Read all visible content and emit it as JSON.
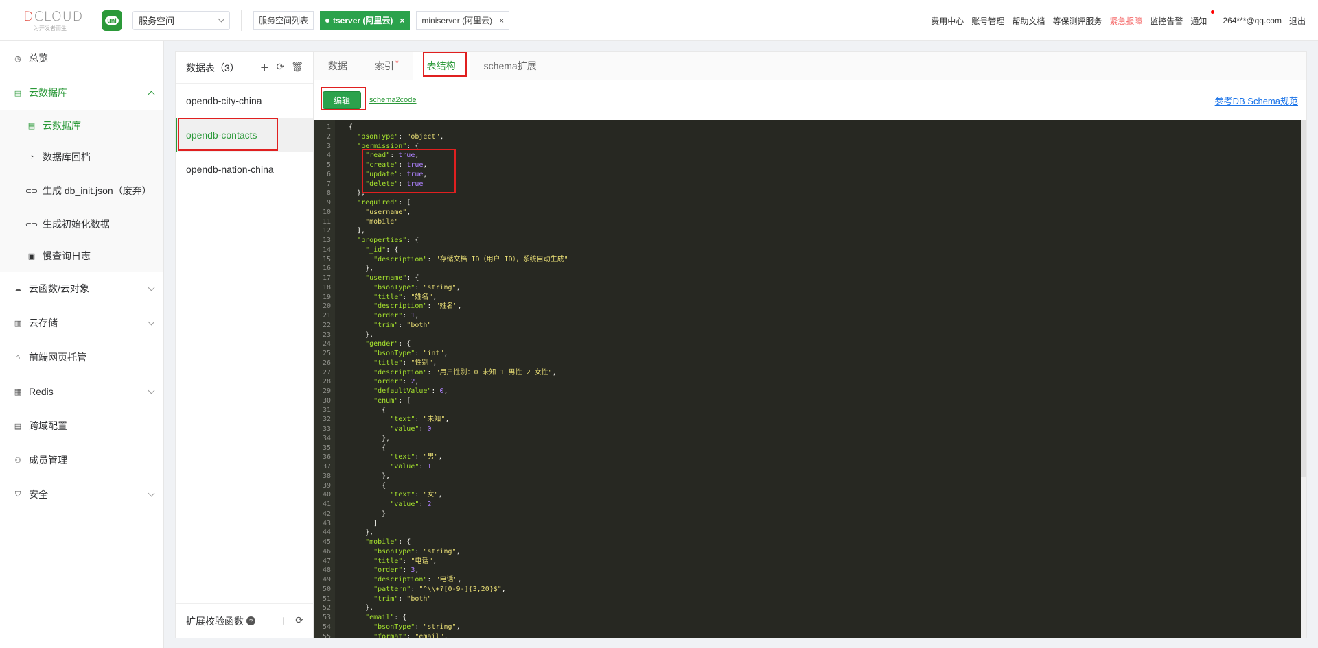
{
  "header": {
    "logo_text_a": "D",
    "logo_text_b": "CLOUD",
    "logo_sub": "为开发者而生",
    "uni_label": "uni",
    "space_select": "服务空间",
    "tabs": [
      {
        "label": "服务空间列表"
      },
      {
        "label": "tserver (阿里云)"
      },
      {
        "label": "miniserver (阿里云)"
      }
    ],
    "close_glyph": "×",
    "links": [
      "费用中心",
      "账号管理",
      "帮助文档",
      "等保测评服务",
      "紧急报障",
      "监控告警"
    ],
    "notice": "通知",
    "user": "264***@qq.com",
    "logout": "退出"
  },
  "sidebar": {
    "items": [
      {
        "label": "总览",
        "icon": "clock-icon"
      },
      {
        "label": "云数据库",
        "icon": "database-icon"
      },
      {
        "label": "云函数/云对象",
        "icon": "cloud-icon"
      },
      {
        "label": "云存储",
        "icon": "storage-icon"
      },
      {
        "label": "前端网页托管",
        "icon": "host-icon"
      },
      {
        "label": "Redis",
        "icon": "redis-icon"
      },
      {
        "label": "跨域配置",
        "icon": "cors-icon"
      },
      {
        "label": "成员管理",
        "icon": "user-icon"
      },
      {
        "label": "安全",
        "icon": "shield-icon"
      }
    ],
    "db_sub": [
      {
        "label": "云数据库"
      },
      {
        "label": "数据库回档"
      },
      {
        "label": "生成 db_init.json（废弃）"
      },
      {
        "label": "生成初始化数据"
      },
      {
        "label": "慢查询日志"
      }
    ]
  },
  "tables": {
    "header": "数据表（3）",
    "items": [
      "opendb-city-china",
      "opendb-contacts",
      "opendb-nation-china"
    ],
    "footer": "扩展校验函数",
    "help": "?"
  },
  "main": {
    "tabs": [
      "数据",
      "索引",
      "表结构",
      "schema扩展"
    ],
    "index_star": "*",
    "edit_button": "编辑",
    "schema2code": "schema2code",
    "ref_link": "参考DB Schema规范"
  },
  "code_lines": [
    "{",
    "  \"bsonType\": \"object\",",
    "  \"permission\": {",
    "    \"read\": true,",
    "    \"create\": true,",
    "    \"update\": true,",
    "    \"delete\": true",
    "  },",
    "  \"required\": [",
    "    \"username\",",
    "    \"mobile\"",
    "  ],",
    "  \"properties\": {",
    "    \"_id\": {",
    "      \"description\": \"存储文档 ID（用户 ID），系统自动生成\"",
    "    },",
    "    \"username\": {",
    "      \"bsonType\": \"string\",",
    "      \"title\": \"姓名\",",
    "      \"description\": \"姓名\",",
    "      \"order\": 1,",
    "      \"trim\": \"both\"",
    "    },",
    "    \"gender\": {",
    "      \"bsonType\": \"int\",",
    "      \"title\": \"性别\",",
    "      \"description\": \"用户性别：0 未知 1 男性 2 女性\",",
    "      \"order\": 2,",
    "      \"defaultValue\": 0,",
    "      \"enum\": [",
    "        {",
    "          \"text\": \"未知\",",
    "          \"value\": 0",
    "        },",
    "        {",
    "          \"text\": \"男\",",
    "          \"value\": 1",
    "        },",
    "        {",
    "          \"text\": \"女\",",
    "          \"value\": 2",
    "        }",
    "      ]",
    "    },",
    "    \"mobile\": {",
    "      \"bsonType\": \"string\",",
    "      \"title\": \"电话\",",
    "      \"order\": 3,",
    "      \"description\": \"电话\",",
    "      \"pattern\": \"^\\\\+?[0-9-]{3,20}$\",",
    "      \"trim\": \"both\"",
    "    },",
    "    \"email\": {",
    "      \"bsonType\": \"string\",",
    "      \"format\": \"email\","
  ],
  "colors": {
    "brand_green": "#2ba24c",
    "editor_bg": "#272822",
    "highlight_red": "#e02020"
  }
}
